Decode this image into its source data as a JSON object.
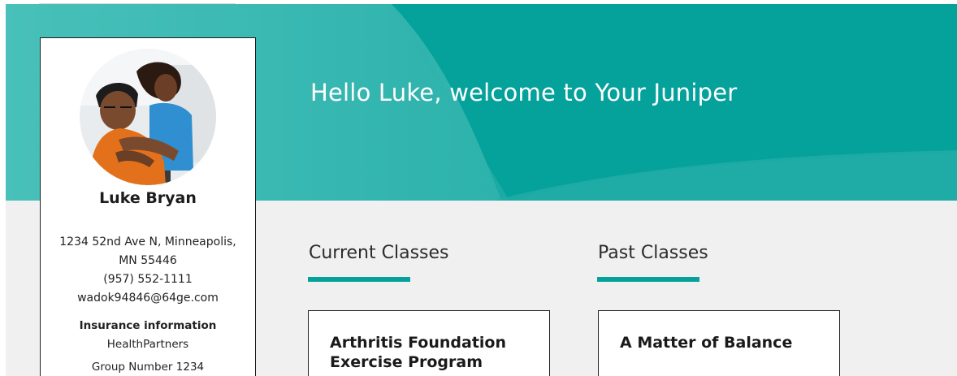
{
  "header": {
    "welcome": "Hello Luke, welcome to Your Juniper"
  },
  "profile": {
    "name": "Luke Bryan",
    "address_line1": "1234 52nd Ave N, Minneapolis,",
    "address_line2": "MN 55446",
    "phone": "(957) 552-1111",
    "email": "wadok94846@64ge.com",
    "insurance_heading": "Insurance information",
    "insurance_provider": "HealthPartners",
    "group_number": "Group Number 1234"
  },
  "current_classes": {
    "heading": "Current Classes",
    "items": [
      {
        "title": "Arthritis Foundation Exercise Program"
      }
    ]
  },
  "past_classes": {
    "heading": "Past Classes",
    "items": [
      {
        "title": "A Matter of Balance"
      }
    ]
  },
  "colors": {
    "brand_teal": "#05a19b",
    "page_background": "#f0f0f0"
  }
}
